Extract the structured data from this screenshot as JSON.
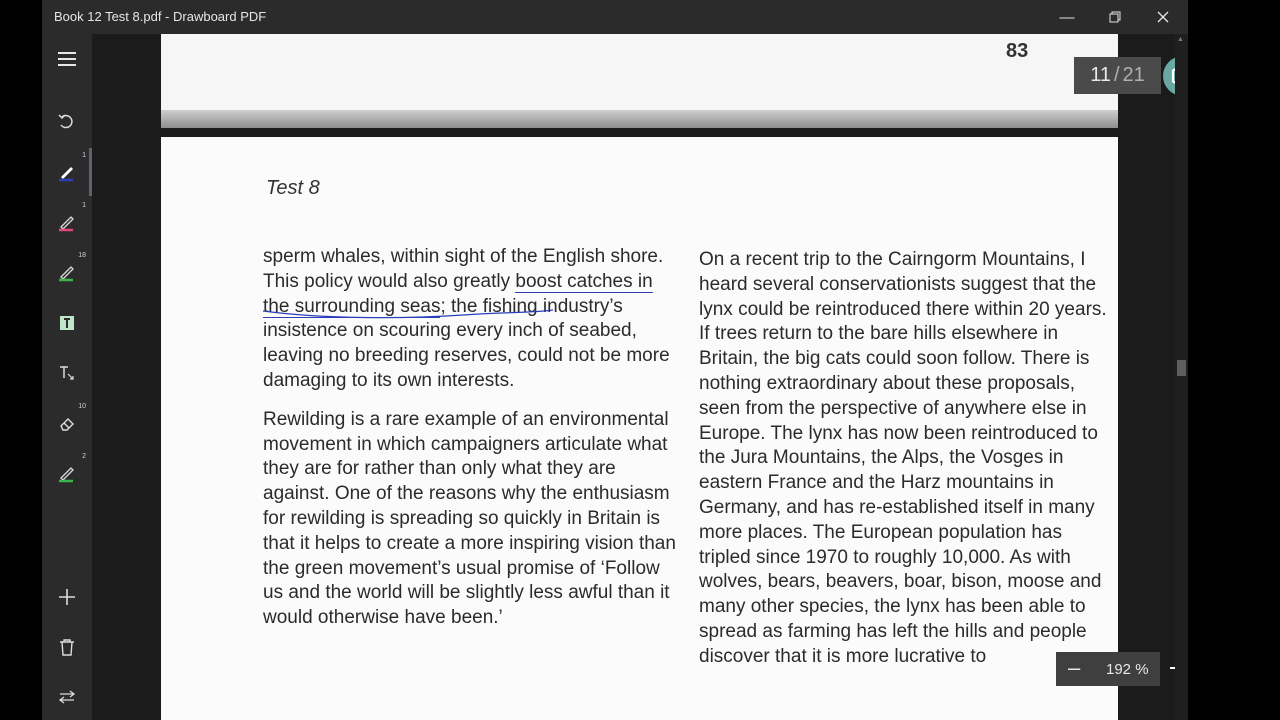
{
  "window": {
    "title": "Book 12 Test 8.pdf - Drawboard PDF"
  },
  "sidebar": {
    "tools": [
      {
        "name": "undo",
        "badge": ""
      },
      {
        "name": "pen-blue",
        "badge": "1"
      },
      {
        "name": "pen-pink",
        "badge": "1"
      },
      {
        "name": "pen-green",
        "badge": "18"
      },
      {
        "name": "highlighter",
        "badge": ""
      },
      {
        "name": "text-tool",
        "badge": ""
      },
      {
        "name": "eraser",
        "badge": "10"
      },
      {
        "name": "pen-green-2",
        "badge": "2"
      }
    ]
  },
  "document": {
    "prev_page_number": "83",
    "heading": "Test 8",
    "col1": {
      "p1_a": "sperm whales, within sight of the English shore. This policy would also greatly ",
      "p1_link": "boost catches in the surrounding seas",
      "p1_b": "; the fishing industry’s insistence on scouring every inch of seabed, leaving no breeding reserves, could not be more damaging to its own interests.",
      "p2": "Rewilding is a rare example of an environmental movement in which campaigners articulate what they are for rather than only what they are against. One of the reasons why the enthusiasm for rewilding is spreading so quickly in Britain is that it helps to create a more inspiring vision than the green movement’s usual promise of ‘Follow us and the world will be slightly less awful than it would otherwise have been.’"
    },
    "col2": {
      "p1": "On a recent trip to the Cairngorm Mountains, I heard several conservationists suggest that the lynx could be reintroduced there within 20 years. If trees return to the bare hills elsewhere in Britain, the big cats could soon follow. There is nothing extraordinary about these proposals, seen from the perspective of anywhere else in Europe. The lynx has now been reintroduced to the Jura Mountains, the Alps, the Vosges in eastern France and the Harz mountains in Germany, and has re-established itself in many more places. The European population has tripled since 1970 to roughly 10,000. As with wolves, bears, beavers, boar, bison, moose and many other species, the lynx has been able to spread as farming has left the hills and people discover that it is more lucrative to"
    }
  },
  "pager": {
    "current": "11",
    "total": "21"
  },
  "zoom": {
    "value": "192 %"
  },
  "colors": {
    "accent": "#6aa8a4",
    "pen_blue": "#2a3fb8"
  }
}
